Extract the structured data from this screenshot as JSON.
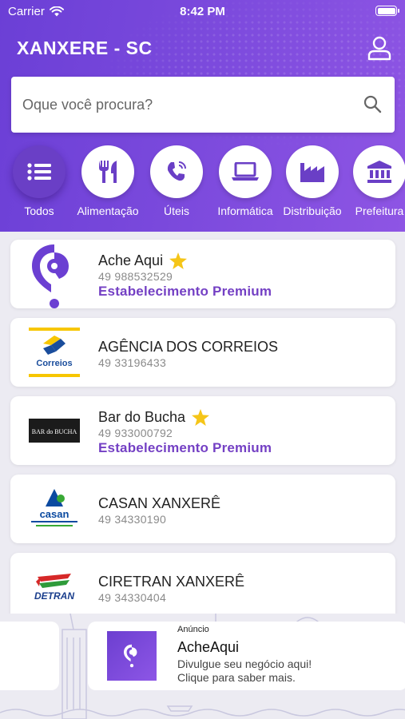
{
  "status": {
    "carrier": "Carrier",
    "time": "8:42 PM"
  },
  "header": {
    "city": "XANXERE - SC"
  },
  "search": {
    "placeholder": "Oque você procura?"
  },
  "categories": [
    {
      "label": "Todos",
      "icon": "list-icon",
      "active": true
    },
    {
      "label": "Alimentação",
      "icon": "utensils-icon"
    },
    {
      "label": "Úteis",
      "icon": "phone-icon"
    },
    {
      "label": "Informática",
      "icon": "laptop-icon"
    },
    {
      "label": "Distribuição",
      "icon": "factory-icon"
    },
    {
      "label": "Prefeitura",
      "icon": "bank-icon"
    }
  ],
  "listings": [
    {
      "name": "Ache Aqui",
      "phone": "49 988532529",
      "premium": "Estabelecimento Premium",
      "starred": true,
      "logo": "acheaqui-logo"
    },
    {
      "name": "AGÊNCIA DOS CORREIOS",
      "phone": "49 33196433",
      "logo": "correios-logo",
      "logo_text": "Correios"
    },
    {
      "name": "Bar do Bucha",
      "phone": "49 933000792",
      "premium": "Estabelecimento Premium",
      "starred": true,
      "logo": "bar-do-bucha-logo",
      "logo_text": "BAR do BUCHA"
    },
    {
      "name": "CASAN XANXERÊ",
      "phone": "49 34330190",
      "logo": "casan-logo",
      "logo_text": "casan"
    },
    {
      "name": "CIRETRAN XANXERÊ",
      "phone": "49 34330404",
      "logo": "detran-logo",
      "logo_text": "DETRAN"
    }
  ],
  "ad": {
    "kicker": "Anúncio",
    "title": "AcheAqui",
    "line1": "Divulgue seu negócio aqui!",
    "line2": "Clique para saber mais."
  },
  "colors": {
    "brand": "#7440c4",
    "header": "#7a49dc",
    "star": "#f5c518"
  }
}
